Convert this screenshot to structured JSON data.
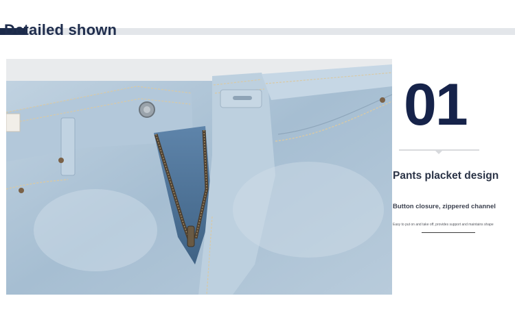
{
  "header": {
    "title": "Detailed shown"
  },
  "feature": {
    "number": "01",
    "title": "Pants placket design",
    "subtitle": "Button closure, zippered channel",
    "description": "Easy to put on and take off, provides support and maintains shape"
  },
  "colors": {
    "navy": "#16234a",
    "denim_light": "#b4c8d9",
    "denim_dark": "#4d6f93"
  }
}
